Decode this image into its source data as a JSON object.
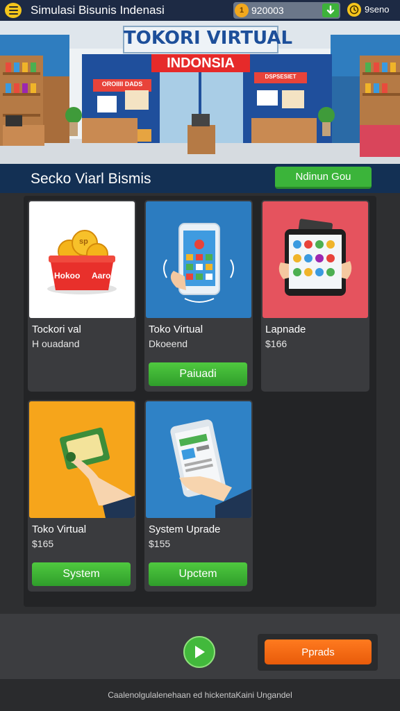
{
  "header": {
    "title": "Simulasi Bisunis Indenasi",
    "coins": "920003",
    "coin_icon_text": "1",
    "gems": "9seno"
  },
  "banner": {
    "sign_top": "TOKORI VIRTUAL",
    "sign_bottom": "INDONSIA",
    "left_sign": "OROIIII DADS",
    "right_sign": "DSPSESIET"
  },
  "section": {
    "title": "Secko Viarl Bismis",
    "button_label": "Ndinun Gou"
  },
  "cards": [
    {
      "name": "Tockori val",
      "subtitle": "H ouadand",
      "thumb_text_1": "Hokoo",
      "thumb_text_2": "Aaro",
      "coin_text": "sp"
    },
    {
      "name": "Toko Virtual",
      "subtitle": "Dkoeend",
      "button": "Paiuadi"
    },
    {
      "name": "Lapnade",
      "subtitle": "$166"
    },
    {
      "name": "Toko Virtual",
      "subtitle": "$165",
      "button": "System"
    },
    {
      "name": "System Uprade",
      "subtitle": "$155",
      "button": "Upctem"
    }
  ],
  "bottom": {
    "orange_button": "Pprads"
  },
  "footer": {
    "text": "Caalenolgulalenehaan ed hickentaKaini Ungandel"
  },
  "colors": {
    "accent_green": "#3bb43a",
    "accent_orange": "#f06a12",
    "header_navy": "#133054",
    "coin_gold": "#f2a81d"
  }
}
